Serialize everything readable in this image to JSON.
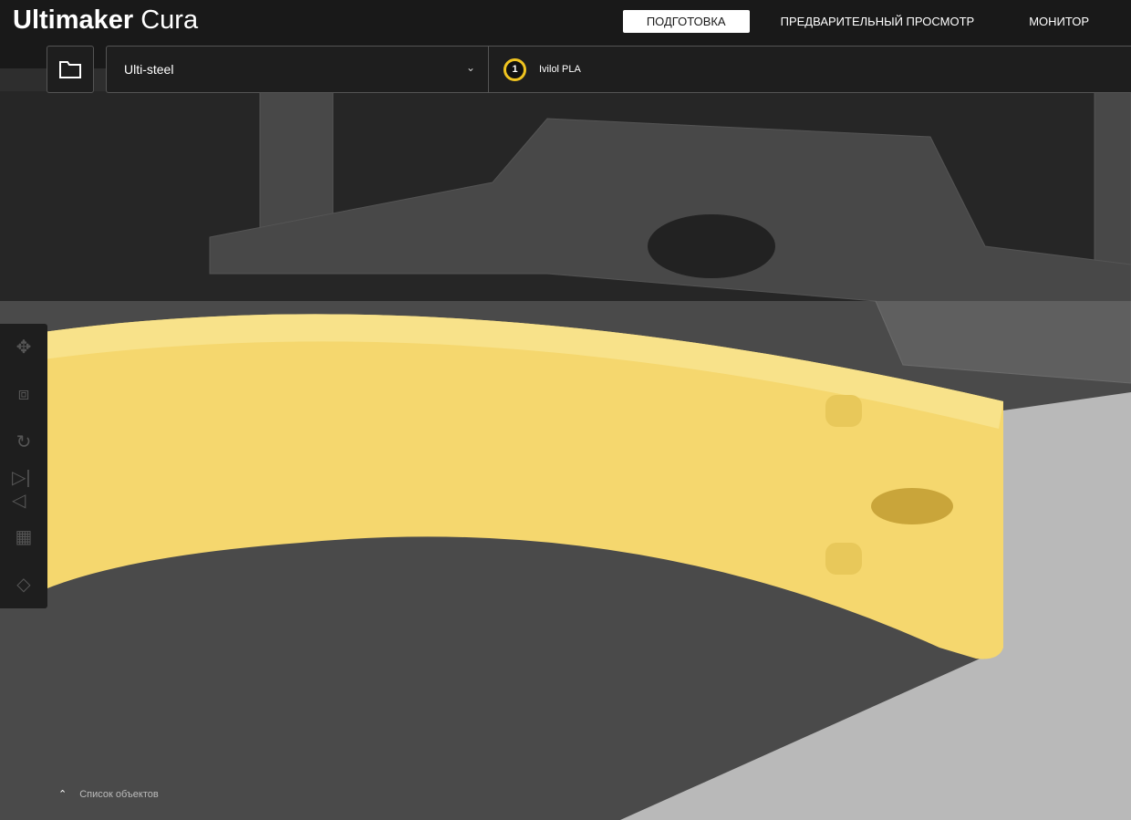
{
  "app": {
    "brand_bold": "Ultimaker",
    "brand_light": "Cura"
  },
  "tabs": [
    {
      "label": "ПОДГОТОВКА",
      "active": true
    },
    {
      "label": "ПРЕДВАРИТЕЛЬНЫЙ ПРОСМОТР",
      "active": false
    },
    {
      "label": "МОНИТОР",
      "active": false
    }
  ],
  "printer": {
    "name": "Ulti-steel"
  },
  "material": {
    "extruder": "1",
    "name": "Ivilol PLA",
    "color": "#f0c420"
  },
  "toolbar": [
    "move",
    "scale",
    "rotate",
    "mirror",
    "per-model-settings",
    "support-blocker"
  ],
  "object_list": {
    "label": "Список объектов"
  },
  "colors": {
    "model": "#f5d76e",
    "bg": "#191919"
  }
}
